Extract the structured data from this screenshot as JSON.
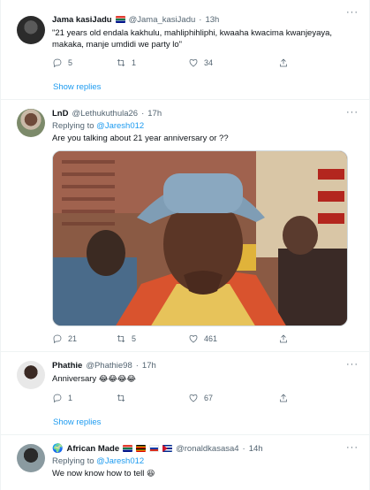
{
  "tweets": [
    {
      "name": "Jama kasiJadu",
      "handle": "@Jama_kasiJadu",
      "time": "13h",
      "text": "\"21 years old endala kakhulu, mahliphihliphi, kwaaha kwacima kwanjeyaya, makaka, manje umdidi we party lo\"",
      "replies": "5",
      "retweets": "1",
      "likes": "34",
      "show_replies": "Show replies"
    },
    {
      "name": "LnD",
      "handle": "@Lethukuthula26",
      "time": "17h",
      "replying_prefix": "Replying to",
      "replying_to": "@Jaresh012",
      "text": "Are you talking about 21 year anniversary or ??",
      "replies": "21",
      "retweets": "5",
      "likes": "461"
    },
    {
      "name": "Phathie",
      "handle": "@Phathie98",
      "time": "17h",
      "text": "Anniversary",
      "emoji": "😂😂😂😂",
      "replies": "1",
      "retweets": "",
      "likes": "67",
      "show_replies": "Show replies"
    },
    {
      "name": "African Made",
      "handle": "@ronaldkasasa4",
      "time": "14h",
      "replying_prefix": "Replying to",
      "replying_to": "@Jaresh012",
      "text": "We now know how to tell",
      "emoji": "😆"
    }
  ],
  "separator": "·",
  "more_glyph": "···",
  "colors": {
    "accent": "#1d9bf0",
    "muted": "#536471",
    "text": "#0f1419"
  }
}
